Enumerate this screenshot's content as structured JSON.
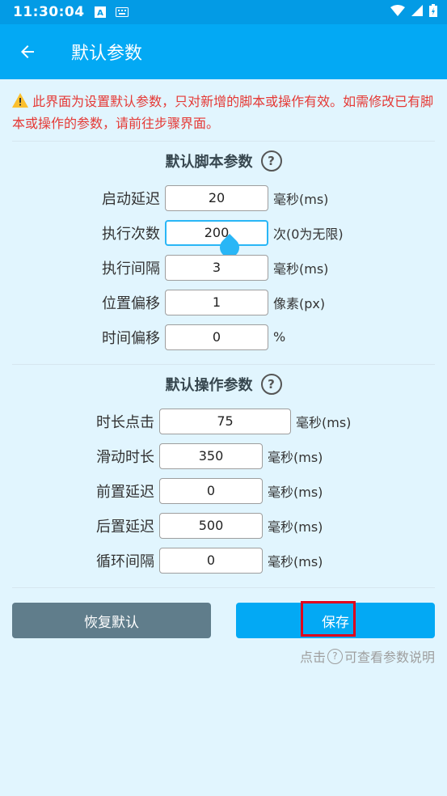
{
  "statusbar": {
    "time": "11:30:04"
  },
  "appbar": {
    "title": "默认参数"
  },
  "notice": "此界面为设置默认参数，只对新增的脚本或操作有效。如需修改已有脚本或操作的参数，请前往步骤界面。",
  "script_section": {
    "title": "默认脚本参数",
    "rows": [
      {
        "label": "启动延迟",
        "value": "20",
        "unit": "毫秒(ms)"
      },
      {
        "label": "执行次数",
        "value": "200",
        "unit": "次(0为无限)"
      },
      {
        "label": "执行间隔",
        "value": "3",
        "unit": "毫秒(ms)"
      },
      {
        "label": "位置偏移",
        "value": "1",
        "unit": "像素(px)"
      },
      {
        "label": "时间偏移",
        "value": "0",
        "unit": "%"
      }
    ]
  },
  "action_section": {
    "title": "默认操作参数",
    "rows": [
      {
        "label": "时长点击",
        "value": "75",
        "unit": "毫秒(ms)"
      },
      {
        "label": "滑动时长",
        "value": "350",
        "unit": "毫秒(ms)"
      },
      {
        "label": "前置延迟",
        "value": "0",
        "unit": "毫秒(ms)"
      },
      {
        "label": "后置延迟",
        "value": "500",
        "unit": "毫秒(ms)"
      },
      {
        "label": "循环间隔",
        "value": "0",
        "unit": "毫秒(ms)"
      }
    ]
  },
  "buttons": {
    "reset": "恢复默认",
    "save": "保存"
  },
  "hint": {
    "before": "点击",
    "after": "可查看参数说明"
  },
  "colors": {
    "appbar": "#03a9f4",
    "statusbar": "#039be5",
    "background": "#e1f5fe",
    "warning": "#e53935",
    "reset": "#607d8b",
    "highlight": "#e0001b"
  }
}
